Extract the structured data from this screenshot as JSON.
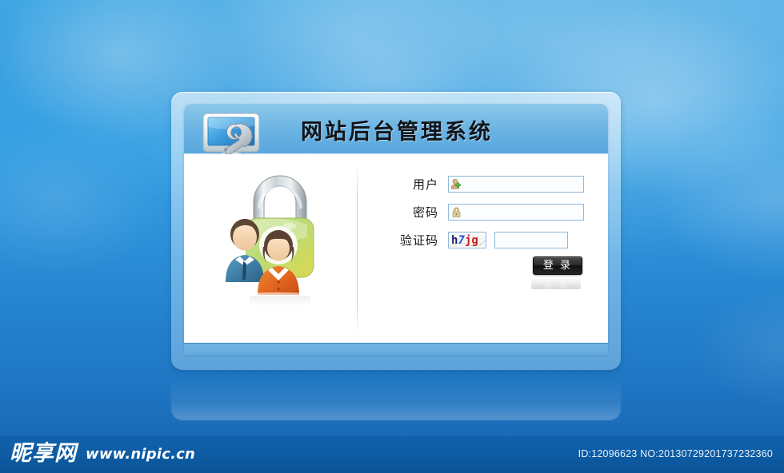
{
  "page": {
    "background_top_color": "#3fa6e3",
    "background_bottom_color": "#17609f"
  },
  "header": {
    "title": "网站后台管理系统",
    "icon": "monitor-wrench-icon",
    "bar_color": "#66b0e2"
  },
  "illustration": {
    "name": "padlock-with-users-illustration",
    "lock_color": "#a8cf63",
    "man_suit_color": "#3f7fa8",
    "woman_coat_color": "#e2651f"
  },
  "form": {
    "fields": [
      {
        "label": "用户",
        "value": "",
        "placeholder": "",
        "icon": "user-add-icon",
        "name": "username"
      },
      {
        "label": "密码",
        "value": "",
        "placeholder": "",
        "icon": "lock-icon",
        "name": "password"
      }
    ],
    "captcha": {
      "label": "验证码",
      "image_text": "h7jg",
      "chars": [
        "h",
        "7",
        "j",
        "g"
      ],
      "colors": [
        "#1a1a6e",
        "#1b53d8",
        "#c02020",
        "#c02020"
      ],
      "input_value": "",
      "input_placeholder": ""
    },
    "submit": {
      "label": "登 录",
      "background": "#1b1b1b",
      "text_color": "#ffffff"
    }
  },
  "footer": {
    "logo_text": "昵享网",
    "logo_url": "www.nipic.cn",
    "id_text": "ID:12096623 NO:20130729201737232360",
    "background_color": "#0d5ba3"
  }
}
